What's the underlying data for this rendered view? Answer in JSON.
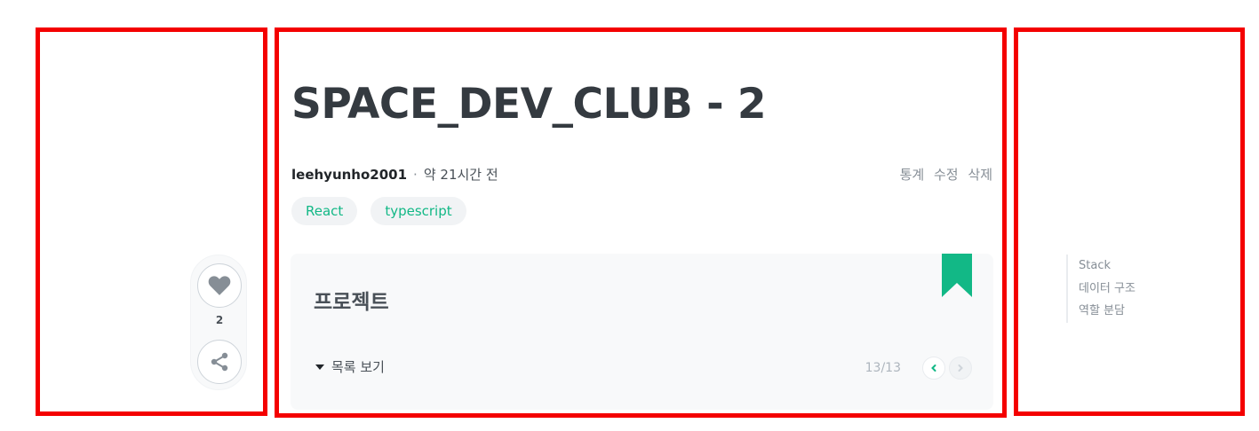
{
  "post": {
    "title": "SPACE_DEV_CLUB - 2",
    "author": "leehyunho2001",
    "separator": "·",
    "time": "약 21시간 전",
    "actions": [
      "통계",
      "수정",
      "삭제"
    ],
    "tags": [
      "React",
      "typescript"
    ]
  },
  "side": {
    "like_count": "2",
    "icons": [
      "heart-icon",
      "share-icon"
    ]
  },
  "series": {
    "title": "프로젝트",
    "toc_toggle": "목록 보기",
    "progress": "13/13",
    "accent": "#12b886"
  },
  "toc": {
    "items": [
      "Stack",
      "데이터 구조",
      "역할 분담"
    ]
  },
  "colors": {
    "highlight_border": "#f40000",
    "accent": "#12b886"
  }
}
